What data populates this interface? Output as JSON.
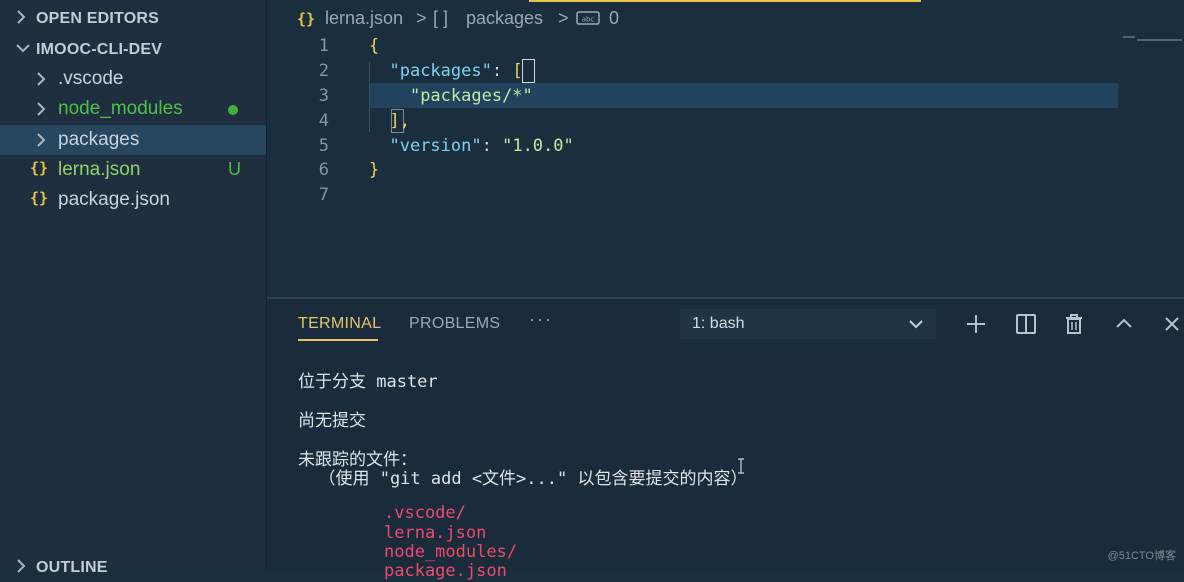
{
  "sidebar": {
    "open_editors_label": "OPEN EDITORS",
    "project_label": "IMOOC-CLI-DEV",
    "items": [
      {
        "label": ".vscode",
        "type": "folder"
      },
      {
        "label": "node_modules",
        "type": "folder",
        "status": "dot"
      },
      {
        "label": "packages",
        "type": "folder",
        "selected": true
      },
      {
        "label": "lerna.json",
        "type": "file",
        "status_badge": "U"
      },
      {
        "label": "package.json",
        "type": "file"
      }
    ],
    "outline_label": "OUTLINE"
  },
  "breadcrumb": {
    "file_icon": "{}",
    "file": "lerna.json",
    "sep1": ">",
    "array_icon": "[ ]",
    "key": "packages",
    "sep2": ">",
    "index": "0"
  },
  "editor": {
    "line_numbers": [
      "1",
      "2",
      "3",
      "4",
      "5",
      "6",
      "7"
    ],
    "lines": {
      "l1_open": "{",
      "l2_key": "\"packages\"",
      "l2_colon": ": ",
      "l2_bracket": "[",
      "l3_value": "\"packages/*\"",
      "l4_close": "],",
      "l5_key": "\"version\"",
      "l5_colon": ": ",
      "l5_value": "\"1.0.0\"",
      "l6_close": "}"
    }
  },
  "panel": {
    "tabs": {
      "terminal": "TERMINAL",
      "problems": "PROBLEMS",
      "more": "···"
    },
    "terminal_select": "1: bash",
    "terminal_lines": {
      "branch": "位于分支 master",
      "no_commits": "尚无提交",
      "untracked_header": "未跟踪的文件：",
      "hint": "  （使用 \"git add <文件>...\" 以包含要提交的内容）",
      "files": [
        ".vscode/",
        "lerna.json",
        "node_modules/",
        "package.json"
      ]
    }
  },
  "watermark": "@51CTO博客",
  "colors": {
    "accent_yellow": "#e5c56a",
    "git_green": "#4dc24a",
    "untracked_red": "#ee4a6c",
    "selection_blue": "#274760"
  }
}
